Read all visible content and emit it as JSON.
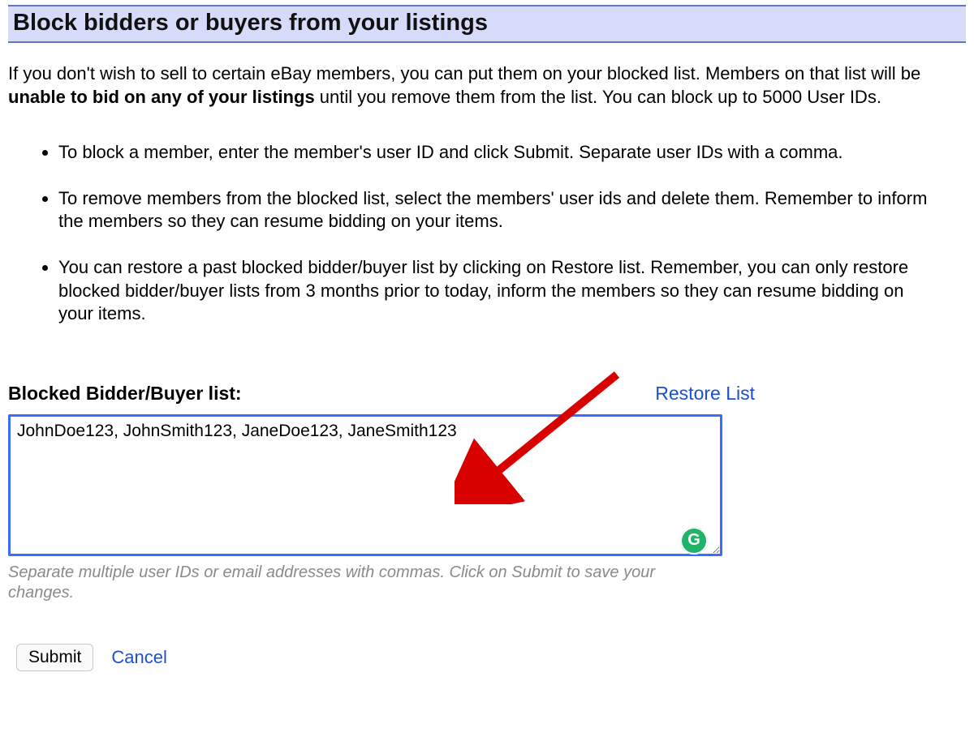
{
  "header": {
    "title": "Block bidders or buyers from your listings"
  },
  "intro": {
    "prefix": "If you don't wish to sell to certain eBay members, you can put them on your blocked list. Members on that list will be ",
    "bold": "unable to bid on any of your listings",
    "suffix": " until you remove them from the list. You can block up to 5000 User IDs."
  },
  "instructions": [
    {
      "prefix": "To block a member, enter the member's user ID and click ",
      "bold": "Submit.",
      "suffix": " Separate user IDs with a comma."
    },
    {
      "prefix": "To remove members from the blocked list, select the members' user ids and delete them. Remember to inform the members so they can resume bidding on your items.",
      "bold": "",
      "suffix": ""
    },
    {
      "prefix": "You can restore a past blocked bidder/buyer list by clicking on Restore list. Remember, you can only restore blocked bidder/buyer lists from 3 months prior to today, inform the members so they can resume bidding on your items.",
      "bold": "",
      "suffix": ""
    }
  ],
  "list": {
    "label": "Blocked Bidder/Buyer list:",
    "restore_label": "Restore List",
    "textarea_value": "JohnDoe123, JohnSmith123, JaneDoe123, JaneSmith123",
    "hint": "Separate multiple user IDs or email addresses with commas. Click on Submit to save your changes.",
    "badge_letter": "G"
  },
  "actions": {
    "submit_label": "Submit",
    "cancel_label": "Cancel"
  },
  "colors": {
    "header_bg": "#d6dbf9",
    "header_border": "#6971b8",
    "link": "#1a4fd1",
    "textarea_border": "#3b6cff",
    "arrow": "#d90000"
  }
}
